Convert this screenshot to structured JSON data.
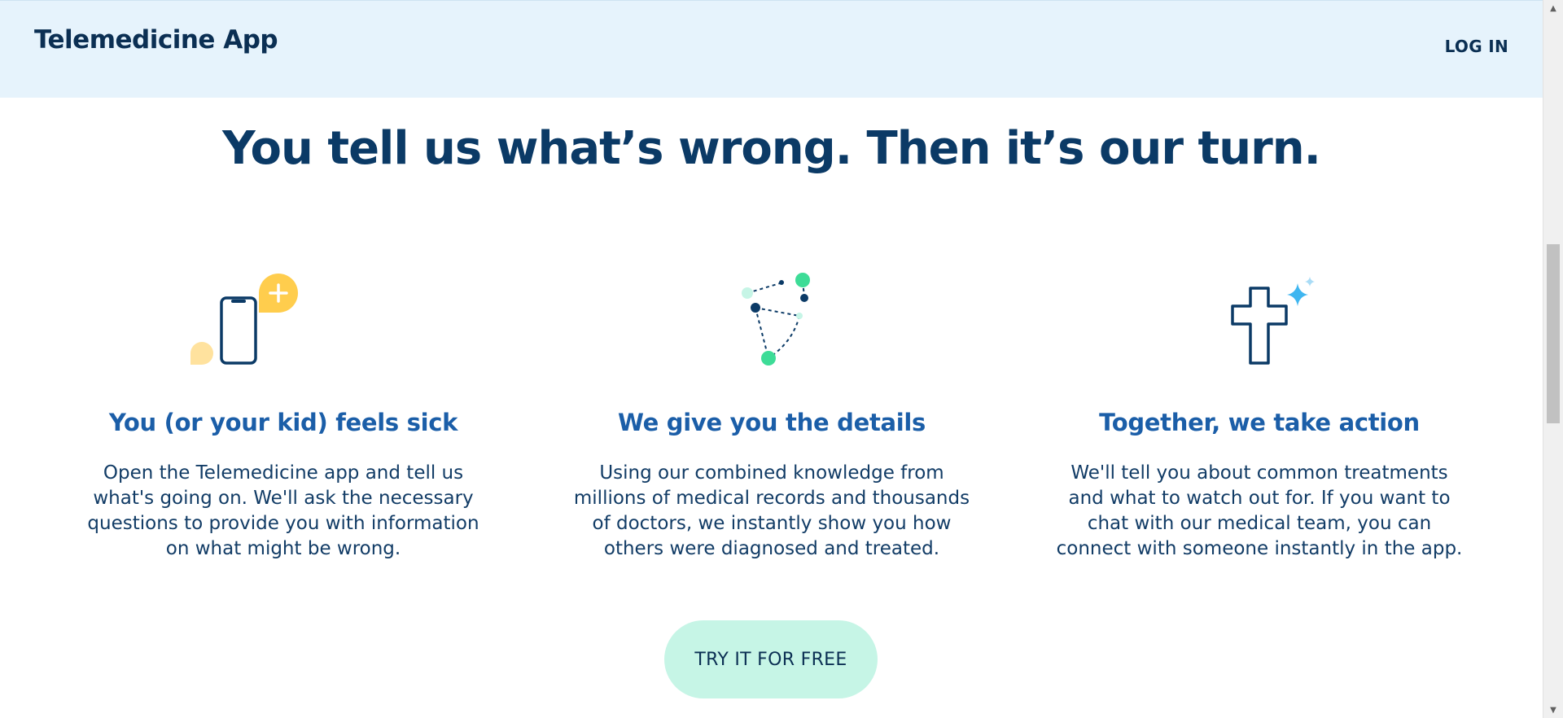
{
  "header": {
    "brand": "Telemedicine App",
    "login_label": "LOG IN"
  },
  "main": {
    "headline": "You tell us what’s wrong. Then it’s our turn.",
    "steps": [
      {
        "icon": "phone-chat-icon",
        "title": "You (or your kid) feels sick",
        "text": "Open the Telemedicine app and tell us what's going on. We'll ask the necessary questions to provide you with information on what might be wrong."
      },
      {
        "icon": "connected-dots-icon",
        "title": "We give you the details",
        "text": "Using our combined knowledge from millions of medical records and thousands of doctors, we instantly show you how others were diagnosed and treated."
      },
      {
        "icon": "medical-cross-sparkle-icon",
        "title": "Together, we take action",
        "text": "We'll tell you about common treatments and what to watch out for. If you want to chat with our medical team, you can connect with someone instantly in the app."
      }
    ],
    "cta_label": "TRY IT FOR FREE"
  },
  "colors": {
    "header_bg": "#e6f3fc",
    "headline": "#0b3a66",
    "step_title": "#1b5ea8",
    "cta_bg": "#c6f5e6",
    "accent_yellow": "#ffcd4d",
    "accent_green": "#3ddc97",
    "accent_blue": "#3fb6f0"
  }
}
